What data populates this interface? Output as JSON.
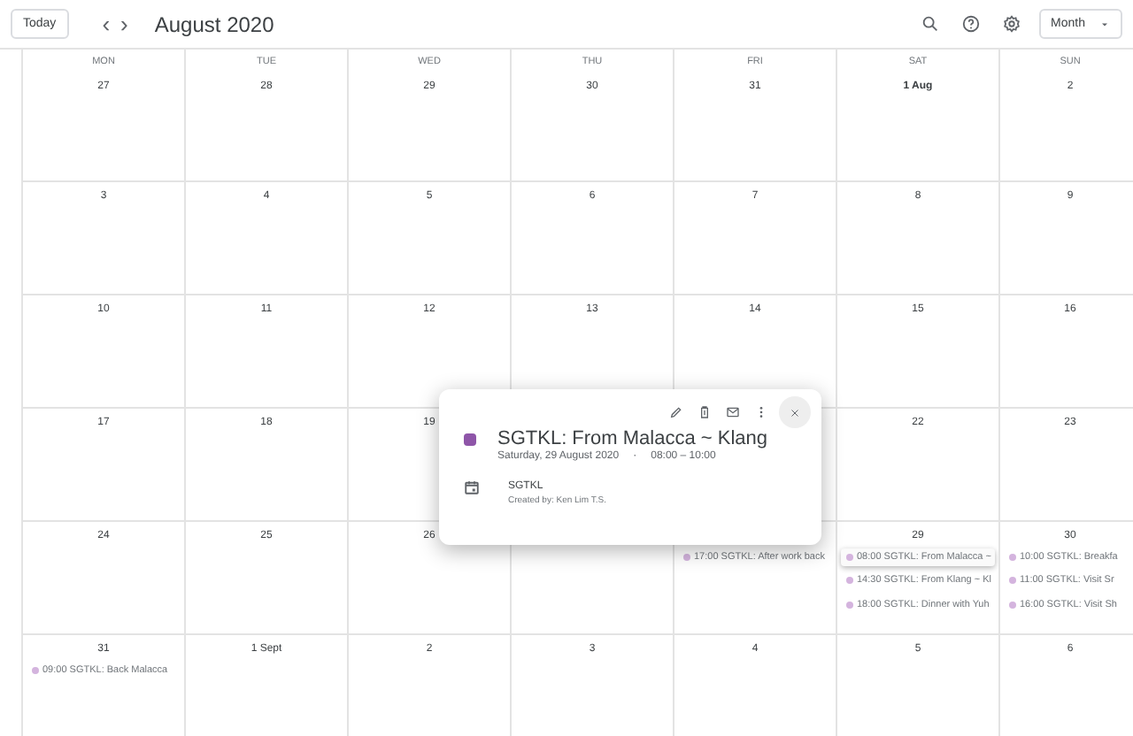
{
  "toolbar": {
    "today": "Today",
    "prev": "‹",
    "next": "›",
    "title": "August 2020",
    "view": "Month"
  },
  "weekdays": [
    "MON",
    "TUE",
    "WED",
    "THU",
    "FRI",
    "SAT",
    "SUN"
  ],
  "weeks": [
    {
      "days": [
        {
          "kind": "day",
          "label": "27"
        },
        {
          "kind": "day",
          "label": "28"
        },
        {
          "kind": "day",
          "label": "29"
        },
        {
          "kind": "day",
          "label": "30"
        },
        {
          "kind": "day",
          "label": "31"
        },
        {
          "kind": "day",
          "label": "1 Aug",
          "emphasis": true
        },
        {
          "kind": "day",
          "label": "2"
        }
      ]
    },
    {
      "days": [
        {
          "kind": "day",
          "label": "3"
        },
        {
          "kind": "day",
          "label": "4"
        },
        {
          "kind": "day",
          "label": "5"
        },
        {
          "kind": "day",
          "label": "6"
        },
        {
          "kind": "day",
          "label": "7"
        },
        {
          "kind": "day",
          "label": "8"
        },
        {
          "kind": "day",
          "label": "9"
        }
      ]
    },
    {
      "days": [
        {
          "kind": "day",
          "label": "10"
        },
        {
          "kind": "day",
          "label": "11"
        },
        {
          "kind": "day",
          "label": "12"
        },
        {
          "kind": "day",
          "label": "13"
        },
        {
          "kind": "day",
          "label": "14"
        },
        {
          "kind": "day",
          "label": "15"
        },
        {
          "kind": "day",
          "label": "16"
        }
      ]
    },
    {
      "days": [
        {
          "kind": "day",
          "label": "17"
        },
        {
          "kind": "day",
          "label": "18"
        },
        {
          "kind": "day",
          "label": "19"
        },
        {
          "kind": "hidden"
        },
        {
          "kind": "covered"
        },
        {
          "kind": "day",
          "label": "22"
        },
        {
          "kind": "day",
          "label": "23"
        }
      ]
    },
    {
      "days": [
        {
          "kind": "day",
          "label": "24"
        },
        {
          "kind": "day",
          "label": "25"
        },
        {
          "kind": "day",
          "label": "26"
        },
        {
          "kind": "covered"
        },
        {
          "kind": "covered",
          "events": [
            {
              "text": "17:00 SGTKL: After work back",
              "selected": false
            }
          ]
        },
        {
          "kind": "day",
          "label": "29",
          "events": [
            {
              "text": "08:00 SGTKL: From Malacca ~",
              "selected": true
            },
            {
              "text": "14:30 SGTKL: From Klang ~ Kl",
              "selected": false
            },
            {
              "text": "18:00 SGTKL: Dinner with Yuh",
              "selected": false
            }
          ]
        },
        {
          "kind": "day",
          "label": "30",
          "events": [
            {
              "text": "10:00 SGTKL: Breakfa",
              "selected": false
            },
            {
              "text": "11:00 SGTKL: Visit Sr",
              "selected": false
            },
            {
              "text": "16:00 SGTKL: Visit Sh",
              "selected": false
            }
          ]
        }
      ]
    },
    {
      "days": [
        {
          "kind": "day",
          "label": "31",
          "events": [
            {
              "text": "09:00 SGTKL: Back Malacca",
              "selected": false
            }
          ]
        },
        {
          "kind": "day",
          "label": "1 Sept"
        },
        {
          "kind": "day",
          "label": "2"
        },
        {
          "kind": "day",
          "label": "3"
        },
        {
          "kind": "day",
          "label": "4"
        },
        {
          "kind": "day",
          "label": "5"
        },
        {
          "kind": "day",
          "label": "6"
        }
      ]
    }
  ],
  "popup": {
    "title": "SGTKL: From Malacca ~ Klang",
    "color": "#8e55a8",
    "date": "Saturday, 29 August 2020",
    "separator": "·",
    "time": "08:00 – 10:00",
    "calendar": "SGTKL",
    "creator": "Created by: Ken Lim T.S."
  }
}
